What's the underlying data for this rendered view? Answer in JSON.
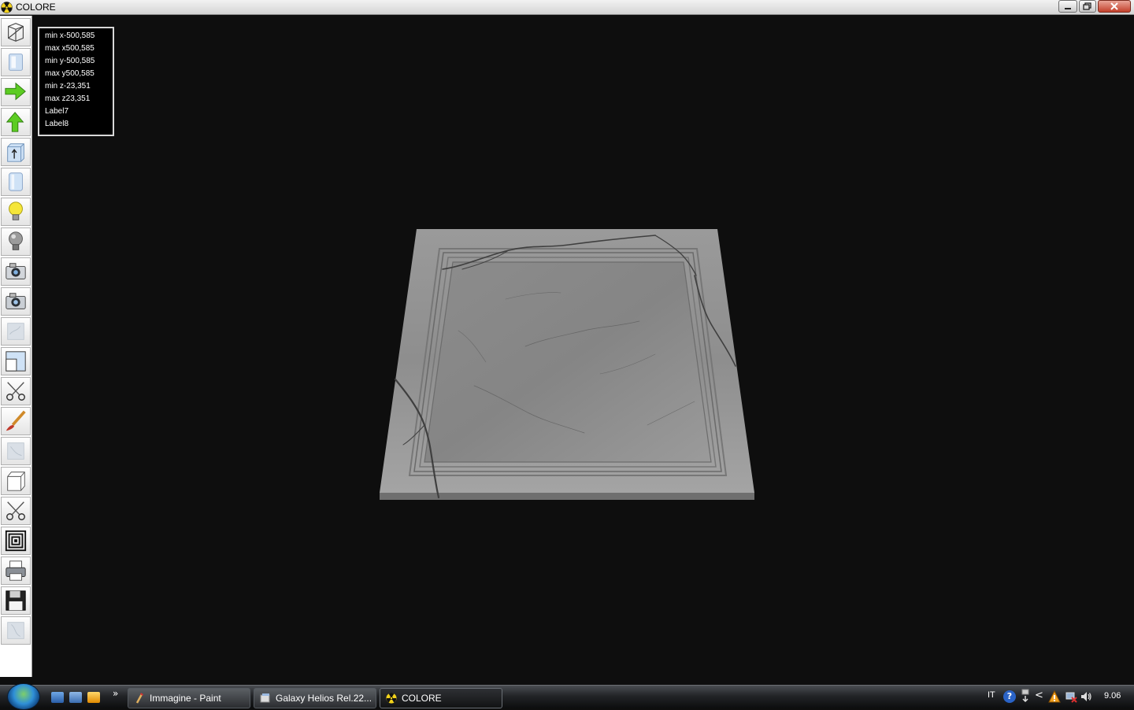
{
  "window": {
    "title": "COLORE",
    "icon": "radiation-icon",
    "controls": [
      "minimize-icon",
      "restore-icon",
      "close-icon"
    ]
  },
  "toolbar": {
    "tools": [
      {
        "icon": "wireframe-cube-icon"
      },
      {
        "icon": "texture-tile-icon"
      },
      {
        "icon": "arrow-right-icon",
        "color": "#5ccc22"
      },
      {
        "icon": "arrow-up-icon",
        "color": "#5ccc22"
      },
      {
        "icon": "box-up-icon"
      },
      {
        "icon": "cylinder-icon"
      },
      {
        "icon": "light-bulb-on-icon",
        "color": "#f5e63a"
      },
      {
        "icon": "light-bulb-off-icon"
      },
      {
        "icon": "camera-icon"
      },
      {
        "icon": "camera-alt-icon"
      },
      {
        "icon": "marble-tile-icon"
      },
      {
        "icon": "viewport-split-icon"
      },
      {
        "icon": "scissors-icon"
      },
      {
        "icon": "brush-icon"
      },
      {
        "icon": "marble-tile-alt-icon"
      },
      {
        "icon": "box-icon"
      },
      {
        "icon": "scissors-alt-icon"
      },
      {
        "icon": "concentric-squares-icon"
      },
      {
        "icon": "printer-icon"
      },
      {
        "icon": "floppy-disk-icon"
      },
      {
        "icon": "marble-tile-extra-icon"
      }
    ]
  },
  "info": {
    "lines": [
      "min x-500,585",
      "max x500,585",
      "min y-500,585",
      "max y500,585",
      "min z-23,351",
      "max z23,351",
      "Label7",
      "Label8"
    ]
  },
  "viewport": {
    "background": "#0e0e0e",
    "object": "marble-slab"
  },
  "taskbar": {
    "start": "windows-orb-icon",
    "quicklaunch_more": "»",
    "tasks": [
      {
        "label": "Immagine - Paint",
        "icon": "paint-icon"
      },
      {
        "label": "Galaxy Helios  Rel.22...",
        "icon": "galaxy-icon"
      },
      {
        "label": "COLORE",
        "icon": "radiation-icon"
      }
    ],
    "tray": {
      "lang": "IT",
      "help": "?",
      "arrow": "<",
      "clock": "9.06"
    }
  }
}
